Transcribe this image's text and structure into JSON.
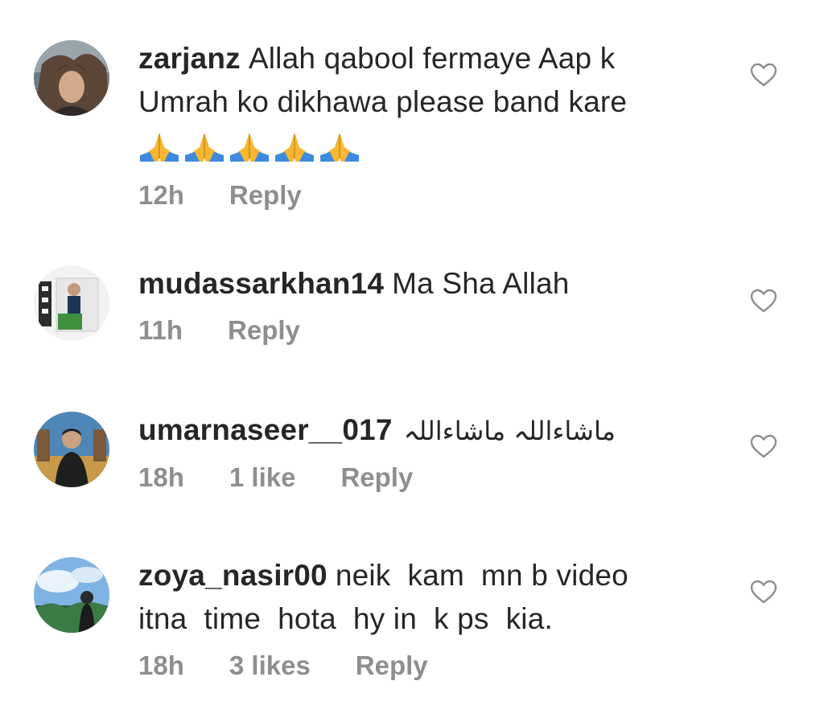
{
  "comments": [
    {
      "username": "zarjanz",
      "text_line1": "Allah qabool fermaye Aap k",
      "text_line2": "Umrah ko dikhawa please band kare",
      "emoji": [
        "🙏",
        "🙏",
        "🙏",
        "🙏",
        "🙏"
      ],
      "time": "12h",
      "reply": "Reply"
    },
    {
      "username": "mudassarkhan14",
      "text": "Ma Sha Allah",
      "time": "11h",
      "reply": "Reply"
    },
    {
      "username": "umarnaseer__017",
      "text": "ماشاءاللہ ماشاءاللہ",
      "time": "18h",
      "likes": "1 like",
      "reply": "Reply"
    },
    {
      "username": "zoya_nasir00",
      "text_line1": "neik  kam  mn b video",
      "text_line2": "itna  time  hota  hy in  k ps  kia.",
      "time": "18h",
      "likes": "3 likes",
      "reply": "Reply"
    }
  ],
  "icons": {
    "like": "heart-outline-icon",
    "pray": "folded-hands-emoji"
  },
  "colors": {
    "text": "#262626",
    "meta": "#8e8e8e",
    "heart": "#8e8e8e",
    "pray_sleeve": "#3d8be0",
    "pray_hands": "#f7b733"
  }
}
